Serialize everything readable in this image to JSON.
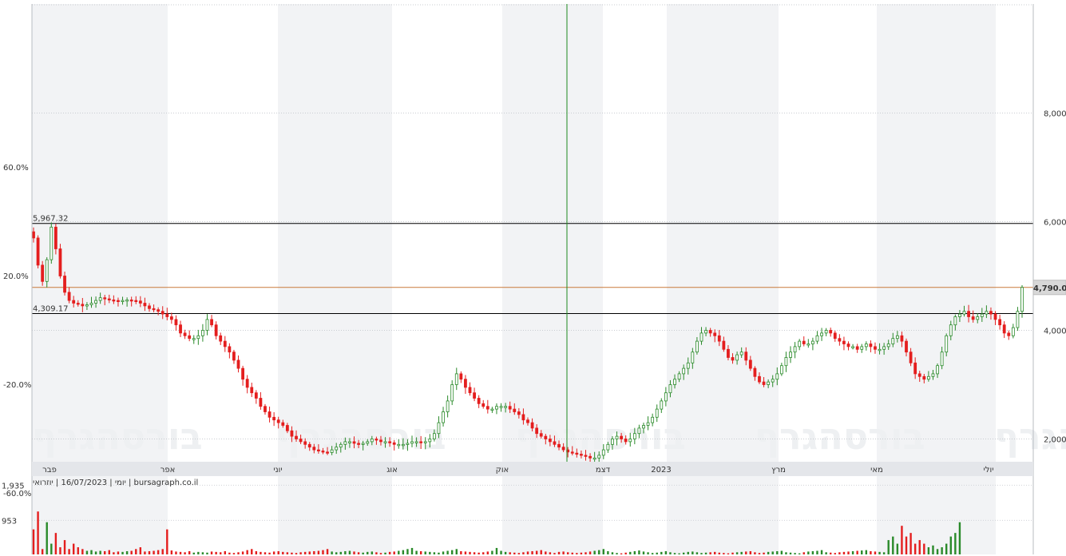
{
  "chart_data": {
    "type": "candlestick",
    "watermark": "בורסהגרף",
    "info_line": "יומי | 16/07/2023 | יוזרואי | bursagraph.co.il",
    "price_axis": {
      "ticks": [
        2000,
        4000,
        6000,
        8000
      ],
      "tick_labels": [
        "2,000",
        "4,000",
        "6,000",
        "8,000"
      ],
      "ylim": [
        1600,
        9000
      ]
    },
    "pct_axis": {
      "ticks": [
        -60,
        -20,
        20,
        60
      ],
      "tick_labels": [
        "-60.0%",
        "-20.0%",
        "20.0%",
        "60.0%"
      ]
    },
    "months": [
      "פבר",
      "אפר",
      "יוני",
      "אוג",
      "אוק",
      "דצמ",
      "2023",
      "מרץ",
      "מאי",
      "יולי"
    ],
    "levels": [
      {
        "value": 5967.32,
        "label": "5,967.32",
        "color": "#000000"
      },
      {
        "value": 4309.17,
        "label": "4,309.17",
        "color": "#000000"
      },
      {
        "value": 4790.0,
        "label": "4,790.00",
        "color": "#c87a3a"
      }
    ],
    "current_price_label": "4,790.00",
    "volume_axis": {
      "ticks": [
        953,
        1935
      ],
      "tick_labels": [
        "953",
        "1,935"
      ]
    },
    "price_path": [
      5700,
      5200,
      4900,
      5300,
      5900,
      5500,
      5000,
      4700,
      4550,
      4500,
      4480,
      4450,
      4470,
      4500,
      4550,
      4600,
      4580,
      4560,
      4550,
      4540,
      4550,
      4560,
      4550,
      4540,
      4500,
      4450,
      4400,
      4380,
      4350,
      4300,
      4250,
      4200,
      4100,
      3950,
      3900,
      3850,
      3850,
      3900,
      4000,
      4200,
      4100,
      3900,
      3800,
      3700,
      3600,
      3450,
      3300,
      3100,
      2950,
      2850,
      2750,
      2600,
      2500,
      2400,
      2350,
      2300,
      2250,
      2150,
      2050,
      2000,
      1950,
      1900,
      1850,
      1800,
      1780,
      1760,
      1750,
      1800,
      1850,
      1900,
      1950,
      1950,
      1920,
      1900,
      1920,
      1950,
      2000,
      1980,
      1950,
      1950,
      1930,
      1900,
      1900,
      1900,
      1920,
      1950,
      1950,
      1930,
      1950,
      2000,
      2100,
      2300,
      2500,
      2700,
      3000,
      3200,
      3100,
      2950,
      2850,
      2750,
      2650,
      2600,
      2550,
      2550,
      2600,
      2600,
      2600,
      2550,
      2500,
      2450,
      2350,
      2300,
      2200,
      2100,
      2050,
      2000,
      1950,
      1900,
      1850,
      1800,
      1760,
      1740,
      1720,
      1700,
      1680,
      1650,
      1650,
      1700,
      1800,
      1900,
      2000,
      2050,
      2000,
      1950,
      2000,
      2100,
      2200,
      2250,
      2300,
      2400,
      2550,
      2700,
      2850,
      3000,
      3100,
      3200,
      3300,
      3400,
      3600,
      3800,
      3950,
      4000,
      3950,
      3900,
      3800,
      3650,
      3500,
      3450,
      3550,
      3600,
      3450,
      3300,
      3150,
      3050,
      3000,
      3050,
      3100,
      3200,
      3350,
      3500,
      3600,
      3700,
      3800,
      3750,
      3750,
      3800,
      3900,
      3950,
      4000,
      3950,
      3850,
      3800,
      3750,
      3700,
      3700,
      3650,
      3700,
      3750,
      3700,
      3650,
      3650,
      3700,
      3750,
      3850,
      3900,
      3800,
      3600,
      3400,
      3200,
      3150,
      3100,
      3150,
      3200,
      3350,
      3600,
      3900,
      4100,
      4250,
      4300,
      4350,
      4250,
      4200,
      4250,
      4300,
      4350,
      4300,
      4200,
      4100,
      3950,
      3900,
      4050,
      4350,
      4790
    ],
    "volume": [
      700,
      1200,
      150,
      900,
      300,
      600,
      200,
      400,
      150,
      300,
      200,
      150,
      100,
      120,
      80,
      100,
      90,
      120,
      60,
      80,
      70,
      90,
      100,
      150,
      200,
      80,
      90,
      100,
      120,
      150,
      700,
      110,
      80,
      70,
      60,
      90,
      50,
      70,
      60,
      50,
      80,
      70,
      60,
      90,
      50,
      40,
      60,
      80,
      120,
      150,
      90,
      70,
      60,
      50,
      80,
      90,
      70,
      60,
      50,
      40,
      60,
      70,
      80,
      90,
      100,
      120,
      150,
      80,
      60,
      70,
      90,
      100,
      80,
      60,
      50,
      70,
      80,
      60,
      40,
      50,
      70,
      80,
      100,
      120,
      150,
      180,
      100,
      90,
      80,
      70,
      60,
      50,
      80,
      100,
      120,
      150,
      90,
      80,
      70,
      60,
      50,
      60,
      80,
      100,
      180,
      100,
      70,
      60,
      50,
      40,
      60,
      80,
      90,
      100,
      120,
      80,
      60,
      40,
      70,
      80,
      60,
      50,
      40,
      50,
      60,
      80,
      100,
      120,
      150,
      90,
      60,
      40,
      30,
      50,
      70,
      90,
      110,
      80,
      60,
      40,
      50,
      70,
      90,
      60,
      40,
      30,
      50,
      70,
      80,
      60,
      40,
      50,
      60,
      70,
      50,
      40,
      30,
      50,
      60,
      70,
      80,
      90,
      60,
      40,
      50,
      70,
      80,
      90,
      100,
      60,
      50,
      40,
      30,
      60,
      80,
      90,
      100,
      120,
      60,
      50,
      40,
      60,
      70,
      80,
      90,
      100,
      110,
      120,
      90,
      80,
      70,
      60,
      400,
      500,
      300,
      800,
      500,
      600,
      300,
      400,
      300,
      200,
      250,
      150,
      200,
      300,
      500,
      600,
      900
    ]
  }
}
